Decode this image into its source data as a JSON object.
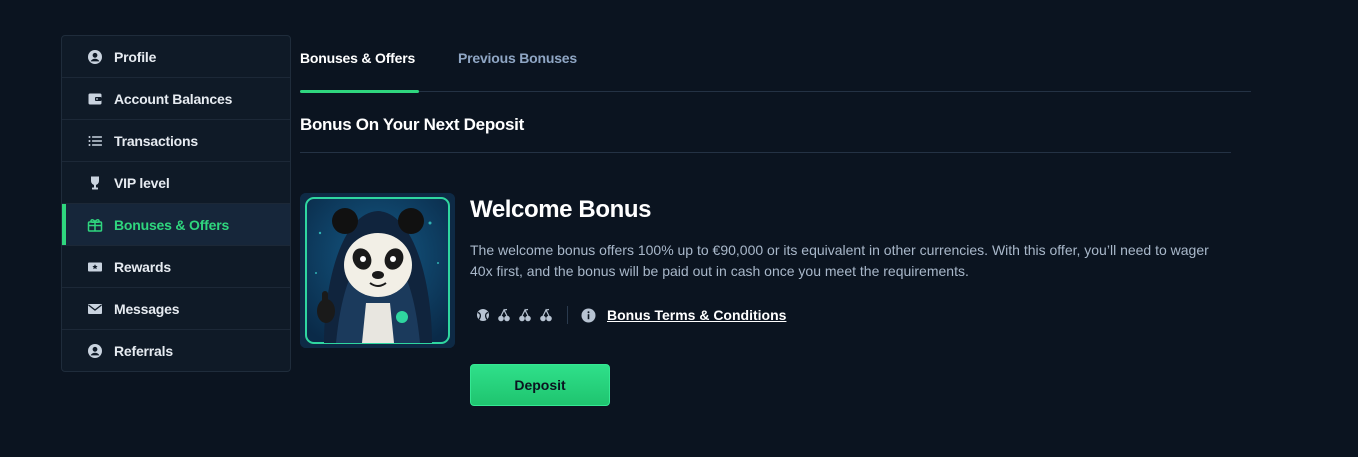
{
  "sidebar": {
    "items": [
      {
        "label": "Profile",
        "icon": "user-circle-icon"
      },
      {
        "label": "Account Balances",
        "icon": "wallet-icon"
      },
      {
        "label": "Transactions",
        "icon": "list-icon"
      },
      {
        "label": "VIP level",
        "icon": "trophy-icon"
      },
      {
        "label": "Bonuses & Offers",
        "icon": "gift-icon",
        "active": true
      },
      {
        "label": "Rewards",
        "icon": "ticket-star-icon"
      },
      {
        "label": "Messages",
        "icon": "envelope-icon"
      },
      {
        "label": "Referrals",
        "icon": "user-circle-icon"
      }
    ]
  },
  "tabs": [
    {
      "label": "Bonuses & Offers",
      "active": true
    },
    {
      "label": "Previous Bonuses",
      "active": false
    }
  ],
  "section": {
    "title": "Bonus On Your Next Deposit"
  },
  "bonus": {
    "title": "Welcome Bonus",
    "description": "The welcome bonus offers 100% up to €90,000 or its equivalent in other currencies. With this offer, you’ll need to wager 40x first, and the bonus will be paid out in cash once you meet the requirements.",
    "terms_label": "Bonus Terms & Conditions",
    "image": "panda-hoodie-illustration",
    "meta_icons": [
      "sports-ball-icon",
      "cherries-icon",
      "cherries-icon",
      "cherries-icon",
      "info-icon"
    ],
    "deposit_label": "Deposit"
  },
  "colors": {
    "accent": "#2fd67e",
    "background": "#0b1420",
    "sidebar_bg": "#0f1a27",
    "muted_text": "#a9b8ca",
    "tab_inactive": "#8fa6c4"
  }
}
